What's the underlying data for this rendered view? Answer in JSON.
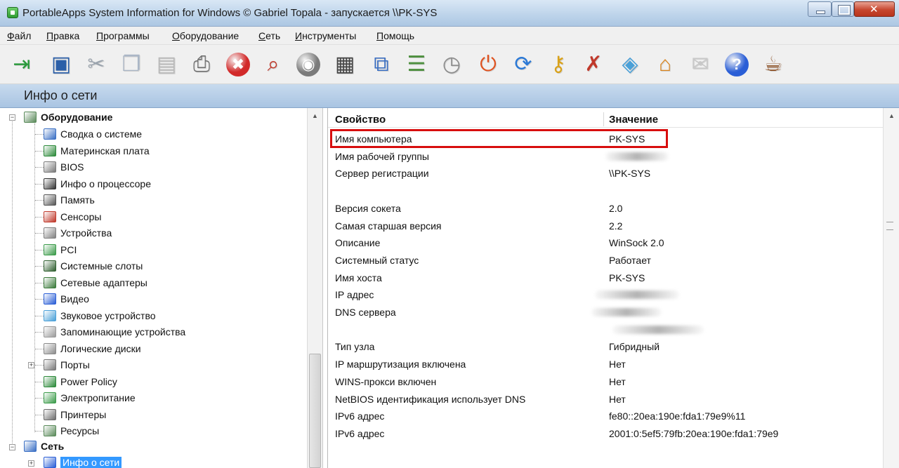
{
  "window": {
    "title": "PortableApps System Information for Windows  © Gabriel Topala - запускается \\\\PK-SYS"
  },
  "menu": [
    "Файл",
    "Правка",
    "Программы",
    "Оборудование",
    "Сеть",
    "Инструменты",
    "Помощь"
  ],
  "toolbar": [
    {
      "icon": "exit-icon",
      "color": "#2a9a3c"
    },
    {
      "icon": "save-icon",
      "color": "#2b5fa8"
    },
    {
      "icon": "cut-icon",
      "color": "#9aa3ad"
    },
    {
      "icon": "copy-icon",
      "color": "#aab6c6"
    },
    {
      "icon": "paste-icon",
      "color": "#b9b9b9"
    },
    {
      "icon": "print-icon",
      "color": "#6b6b6b"
    },
    {
      "icon": "stop-icon",
      "color": "#d22a2a"
    },
    {
      "icon": "find-icon",
      "color": "#c0392b"
    },
    {
      "icon": "gauge-icon",
      "color": "#7b7b7b"
    },
    {
      "icon": "memory-icon",
      "color": "#444444"
    },
    {
      "icon": "network-icon",
      "color": "#3a6fc4"
    },
    {
      "icon": "list-icon",
      "color": "#4d8f3e"
    },
    {
      "icon": "stopwatch-icon",
      "color": "#8c8c8c"
    },
    {
      "icon": "power-icon",
      "color": "#e0521f"
    },
    {
      "icon": "refresh-icon",
      "color": "#2b79d6"
    },
    {
      "icon": "key-icon",
      "color": "#d9a21a"
    },
    {
      "icon": "tools-icon",
      "color": "#c0392b"
    },
    {
      "icon": "map-icon",
      "color": "#4aa0d8"
    },
    {
      "icon": "home-icon",
      "color": "#d9831a"
    },
    {
      "icon": "mail-icon",
      "color": "#c8c8c8"
    },
    {
      "icon": "help-icon",
      "color": "#2a5ed6"
    },
    {
      "icon": "coffee-icon",
      "color": "#8a4b1e"
    }
  ],
  "section": {
    "title": "Инфо о сети"
  },
  "tree": {
    "hardware": {
      "label": "Оборудование",
      "children": [
        {
          "label": "Сводка о системе",
          "icon": "computer-icon",
          "color": "#3a6fc4"
        },
        {
          "label": "Материнская плата",
          "icon": "motherboard-icon",
          "color": "#2c8a3a"
        },
        {
          "label": "BIOS",
          "icon": "bios-icon",
          "color": "#7a7a7a"
        },
        {
          "label": "Инфо о процессоре",
          "icon": "cpu-icon",
          "color": "#333333"
        },
        {
          "label": "Память",
          "icon": "memory-icon",
          "color": "#555555"
        },
        {
          "label": "Сенсоры",
          "icon": "sensor-icon",
          "color": "#c0392b"
        },
        {
          "label": "Устройства",
          "icon": "devices-icon",
          "color": "#808080"
        },
        {
          "label": "PCI",
          "icon": "pci-icon",
          "color": "#3b9b4a"
        },
        {
          "label": "Системные слоты",
          "icon": "slots-icon",
          "color": "#2f5f2f"
        },
        {
          "label": "Сетевые адаптеры",
          "icon": "network-adapter-icon",
          "color": "#3a7a3a"
        },
        {
          "label": "Видео",
          "icon": "video-icon",
          "color": "#2a5ed6"
        },
        {
          "label": "Звуковое устройство",
          "icon": "sound-icon",
          "color": "#4aa0d8"
        },
        {
          "label": "Запоминающие устройства",
          "icon": "storage-icon",
          "color": "#9a9a9a"
        },
        {
          "label": "Логические диски",
          "icon": "disk-icon",
          "color": "#8a8a8a"
        },
        {
          "label": "Порты",
          "icon": "ports-icon",
          "color": "#777777"
        },
        {
          "label": "Power Policy",
          "icon": "power-policy-icon",
          "color": "#2c8a3a"
        },
        {
          "label": "Электропитание",
          "icon": "battery-icon",
          "color": "#3b9b4a"
        },
        {
          "label": "Принтеры",
          "icon": "printer-icon",
          "color": "#6b6b6b"
        },
        {
          "label": "Ресурсы",
          "icon": "resources-icon",
          "color": "#5a8a5a"
        }
      ]
    },
    "network": {
      "label": "Сеть",
      "children": [
        {
          "label": "Инфо о сети",
          "icon": "info-icon",
          "color": "#2a5ed6"
        }
      ]
    }
  },
  "details": {
    "headers": {
      "property": "Свойство",
      "value": "Значение"
    },
    "rows": [
      {
        "name": "Имя компьютера",
        "value": "PK-SYS"
      },
      {
        "name": "Имя рабочей группы",
        "value": ""
      },
      {
        "name": "Сервер регистрации",
        "value": "\\\\PK-SYS"
      },
      {
        "name": "",
        "value": ""
      },
      {
        "name": "Версия сокета",
        "value": "2.0"
      },
      {
        "name": "Самая старшая версия",
        "value": "2.2"
      },
      {
        "name": "Описание",
        "value": "WinSock 2.0"
      },
      {
        "name": "Системный статус",
        "value": "Работает"
      },
      {
        "name": "Имя хоста",
        "value": "PK-SYS"
      },
      {
        "name": "IP адрес",
        "value": ""
      },
      {
        "name": "DNS сервера",
        "value": ""
      },
      {
        "name": "",
        "value": ""
      },
      {
        "name": "Тип узла",
        "value": "Гибридный"
      },
      {
        "name": "IP маршрутизация включена",
        "value": "Нет"
      },
      {
        "name": "WINS-прокси включен",
        "value": "Нет"
      },
      {
        "name": "NetBIOS идентификация использует DNS",
        "value": "Нет"
      },
      {
        "name": "IPv6 адрес",
        "value": "fe80::20ea:190e:fda1:79e9%11"
      },
      {
        "name": "IPv6 адрес",
        "value": "2001:0:5ef5:79fb:20ea:190e:fda1:79e9"
      }
    ]
  }
}
